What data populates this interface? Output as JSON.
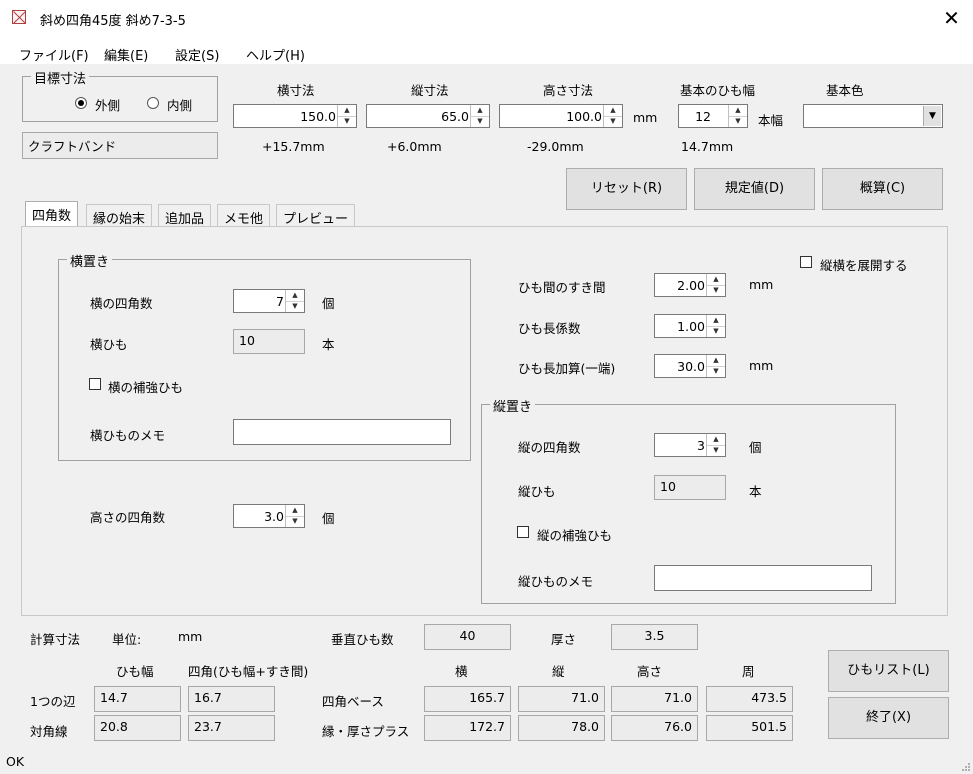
{
  "window": {
    "title": "斜め四角45度 斜め7-3-5",
    "close": "✕"
  },
  "menu": [
    "ファイル(F)",
    "編集(E)",
    "設定(S)",
    "ヘルプ(H)"
  ],
  "target": {
    "group_title": "目標寸法",
    "outer_label": "外側",
    "inner_label": "内側",
    "selected": "外側"
  },
  "band_name": "クラフトバンド",
  "dims": {
    "width_label": "横寸法",
    "width_value": "150.0",
    "width_diff": "+15.7mm",
    "depth_label": "縦寸法",
    "depth_value": "65.0",
    "depth_diff": "+6.0mm",
    "height_label": "高さ寸法",
    "height_value": "100.0",
    "height_diff": "-29.0mm",
    "unit": "mm",
    "band_width_label": "基本のひも幅",
    "band_width_value": "12",
    "band_width_unit": "本幅",
    "band_width_mm": "14.7mm",
    "color_label": "基本色",
    "color_value": ""
  },
  "buttons": {
    "reset": "リセット(R)",
    "default": "規定値(D)",
    "estimate": "概算(C)",
    "list": "ひもリスト(L)",
    "exit": "終了(X)"
  },
  "tabs": [
    "四角数",
    "縁の始末",
    "追加品",
    "メモ他",
    "プレビュー"
  ],
  "panel": {
    "yoko_group": "横置き",
    "yoko_count_label": "横の四角数",
    "yoko_count_value": "7",
    "yoko_count_unit": "個",
    "yoko_himo_label": "横ひも",
    "yoko_himo_value": "10",
    "yoko_himo_unit": "本",
    "yoko_reinforce_label": "横の補強ひも",
    "yoko_memo_label": "横ひものメモ",
    "yoko_memo_value": "",
    "height_count_label": "高さの四角数",
    "height_count_value": "3.0",
    "height_count_unit": "個",
    "expand_label": "縦横を展開する",
    "gap_label": "ひも間のすき間",
    "gap_value": "2.00",
    "gap_unit": "mm",
    "coef_label": "ひも長係数",
    "coef_value": "1.00",
    "add_label": "ひも長加算(一端)",
    "add_value": "30.0",
    "add_unit": "mm",
    "tate_group": "縦置き",
    "tate_count_label": "縦の四角数",
    "tate_count_value": "3",
    "tate_count_unit": "個",
    "tate_himo_label": "縦ひも",
    "tate_himo_value": "10",
    "tate_himo_unit": "本",
    "tate_reinforce_label": "縦の補強ひも",
    "tate_memo_label": "縦ひものメモ",
    "tate_memo_value": ""
  },
  "calc": {
    "title": "計算寸法",
    "unit_label": "単位:",
    "unit_value": "mm",
    "vertical_label": "垂直ひも数",
    "vertical_value": "40",
    "thickness_label": "厚さ",
    "thickness_value": "3.5",
    "col_himo": "ひも幅",
    "col_square": "四角(ひも幅+すき間)",
    "col_yoko": "横",
    "col_tate": "縦",
    "col_height": "高さ",
    "col_perim": "周",
    "row1_label": "1つの辺",
    "row1_himo": "14.7",
    "row1_square": "16.7",
    "row2_label": "対角線",
    "row2_himo": "20.8",
    "row2_square": "23.7",
    "base_label": "四角ベース",
    "base_yoko": "165.7",
    "base_tate": "71.0",
    "base_height": "71.0",
    "base_perim": "473.5",
    "plus_label": "縁・厚さプラス",
    "plus_yoko": "172.7",
    "plus_tate": "78.0",
    "plus_height": "76.0",
    "plus_perim": "501.5"
  },
  "status": "OK"
}
